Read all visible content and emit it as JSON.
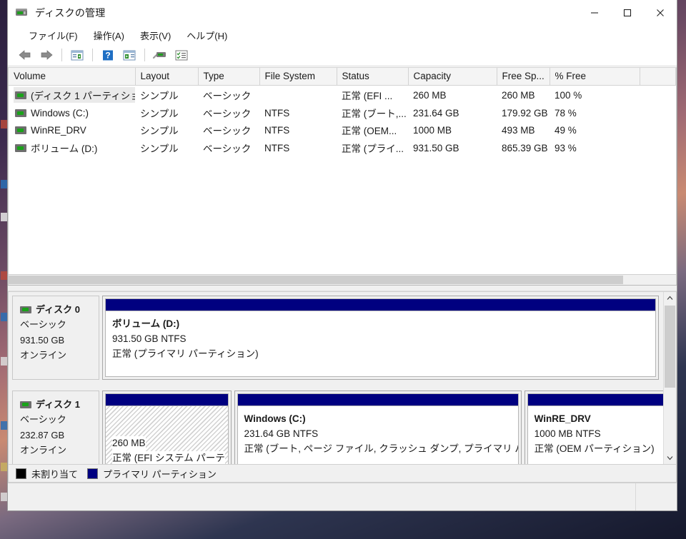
{
  "window": {
    "title": "ディスクの管理",
    "icon": "disk-management-icon",
    "controls": {
      "minimize": "最小化",
      "maximize": "最大化",
      "close": "閉じる"
    }
  },
  "menubar": {
    "items": [
      {
        "label": "ファイル(F)",
        "name": "menu-file"
      },
      {
        "label": "操作(A)",
        "name": "menu-action"
      },
      {
        "label": "表示(V)",
        "name": "menu-view"
      },
      {
        "label": "ヘルプ(H)",
        "name": "menu-help"
      }
    ]
  },
  "toolbar": {
    "buttons": [
      {
        "icon": "back-arrow-icon",
        "name": "toolbar-back"
      },
      {
        "icon": "forward-arrow-icon",
        "name": "toolbar-forward"
      },
      {
        "icon": "properties-icon",
        "name": "toolbar-properties"
      },
      {
        "icon": "help-icon",
        "name": "toolbar-help"
      },
      {
        "icon": "action-pane-icon",
        "name": "toolbar-action-pane"
      },
      {
        "icon": "disk-icon",
        "name": "toolbar-disk"
      },
      {
        "icon": "task-list-icon",
        "name": "toolbar-task-list"
      }
    ]
  },
  "volume_list": {
    "columns": [
      "Volume",
      "Layout",
      "Type",
      "File System",
      "Status",
      "Capacity",
      "Free Sp...",
      "% Free"
    ],
    "rows": [
      {
        "volume": "(ディスク 1 パーティショ...",
        "layout": "シンプル",
        "type": "ベーシック",
        "file_system": "",
        "status": "正常 (EFI ...",
        "capacity": "260 MB",
        "free_space": "260 MB",
        "percent_free": "100 %",
        "selected": true
      },
      {
        "volume": "Windows (C:)",
        "layout": "シンプル",
        "type": "ベーシック",
        "file_system": "NTFS",
        "status": "正常 (ブート,...",
        "capacity": "231.64 GB",
        "free_space": "179.92 GB",
        "percent_free": "78 %",
        "selected": false
      },
      {
        "volume": "WinRE_DRV",
        "layout": "シンプル",
        "type": "ベーシック",
        "file_system": "NTFS",
        "status": "正常 (OEM...",
        "capacity": "1000 MB",
        "free_space": "493 MB",
        "percent_free": "49 %",
        "selected": false
      },
      {
        "volume": "ボリューム (D:)",
        "layout": "シンプル",
        "type": "ベーシック",
        "file_system": "NTFS",
        "status": "正常 (プライ...",
        "capacity": "931.50 GB",
        "free_space": "865.39 GB",
        "percent_free": "93 %",
        "selected": false
      }
    ]
  },
  "graphical_view": {
    "disks": [
      {
        "name": "ディスク 0",
        "type": "ベーシック",
        "size": "931.50 GB",
        "status": "オンライン",
        "partitions": [
          {
            "title": "ボリューム  (D:)",
            "size_fs": "931.50 GB NTFS",
            "status": "正常 (プライマリ パーティション)",
            "hatched": false,
            "width_pct": 100
          }
        ]
      },
      {
        "name": "ディスク 1",
        "type": "ベーシック",
        "size": "232.87 GB",
        "status": "オンライン",
        "partitions": [
          {
            "title": "",
            "size_fs": "260 MB",
            "status": "正常 (EFI システム パーテ",
            "hatched": true,
            "width_pct": 22
          },
          {
            "title": "Windows  (C:)",
            "size_fs": "231.64 GB NTFS",
            "status": "正常 (ブート, ページ ファイル, クラッシュ ダンプ, プライマリ パー",
            "hatched": false,
            "width_pct": 49
          },
          {
            "title": "WinRE_DRV",
            "size_fs": "1000 MB NTFS",
            "status": "正常 (OEM パーティション)",
            "hatched": false,
            "width_pct": 29
          }
        ]
      }
    ],
    "scrollbar": {
      "up_arrow": "chevron-up-icon",
      "down_arrow": "chevron-down-icon"
    }
  },
  "legend": {
    "items": [
      {
        "label": "未割り当て",
        "color": "#000000",
        "name": "legend-unallocated"
      },
      {
        "label": "プライマリ パーティション",
        "color": "#000080",
        "name": "legend-primary-partition"
      }
    ]
  },
  "colors": {
    "partition_bar": "#000080",
    "unallocated": "#000000",
    "window_bg": "#ffffff",
    "pane_bg": "#f0f0f0"
  }
}
